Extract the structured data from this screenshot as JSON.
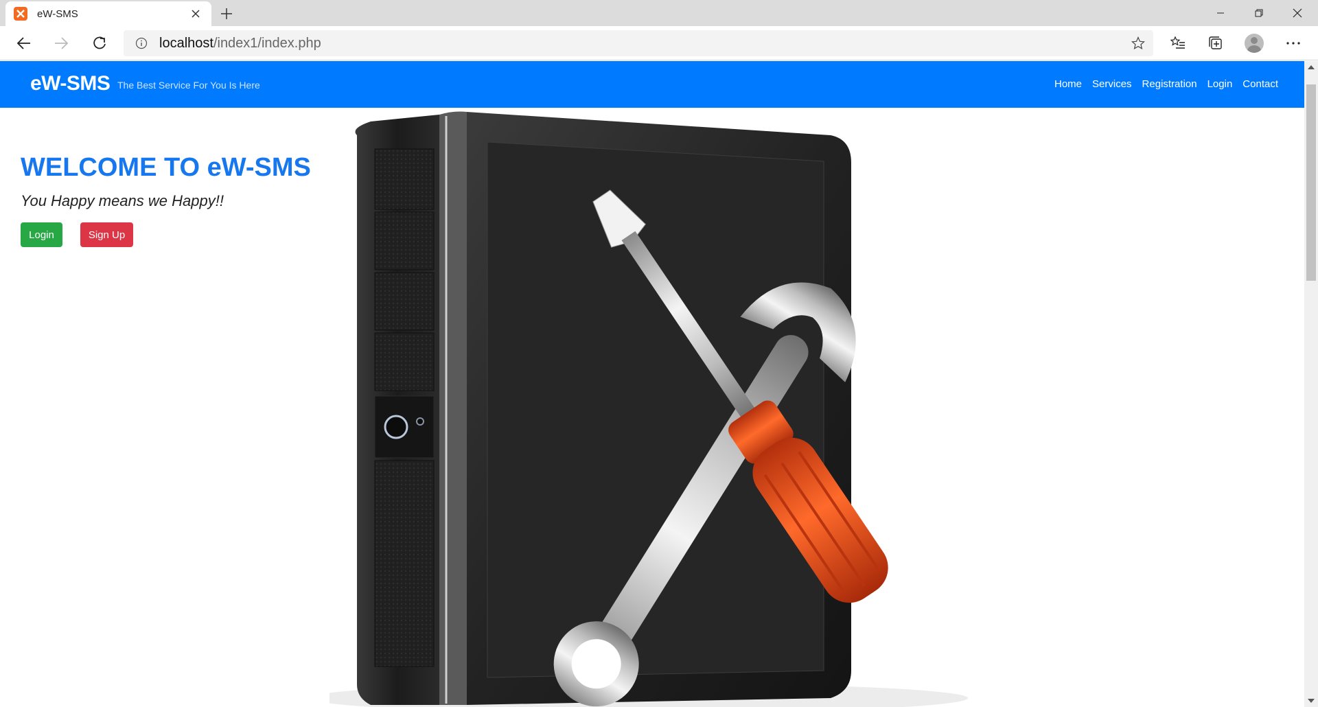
{
  "browser": {
    "tab_title": "eW-SMS",
    "url_host": "localhost",
    "url_path": "/index1/index.php"
  },
  "site": {
    "brand": "eW-SMS",
    "tagline": "The Best Service For You Is Here",
    "nav": [
      "Home",
      "Services",
      "Registration",
      "Login",
      "Contact"
    ]
  },
  "hero": {
    "title": "WELCOME TO eW-SMS",
    "subtitle": "You Happy means we Happy!!",
    "login_label": "Login",
    "signup_label": "Sign Up"
  },
  "colors": {
    "nav_bg": "#007bff",
    "title": "#1677ee",
    "login_btn": "#28a745",
    "signup_btn": "#dc3545",
    "screwdriver_handle": "#e8501a"
  },
  "icons": [
    "xampp-favicon-icon",
    "close-icon",
    "plus-icon",
    "minimize-icon",
    "restore-icon",
    "back-icon",
    "forward-icon",
    "reload-icon",
    "info-icon",
    "star-icon",
    "favorites-icon",
    "collections-icon",
    "profile-icon",
    "more-icon",
    "chevron-up-icon",
    "chevron-down-icon"
  ]
}
